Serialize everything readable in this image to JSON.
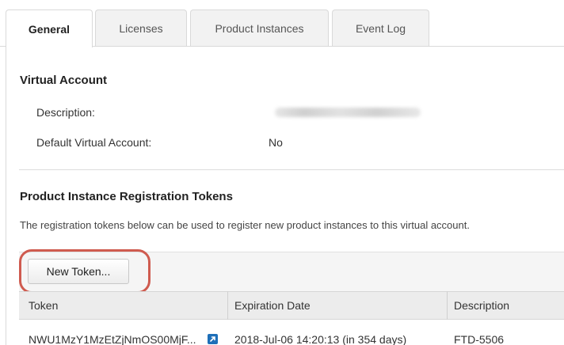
{
  "tabs": [
    {
      "label": "General",
      "active": true
    },
    {
      "label": "Licenses",
      "active": false
    },
    {
      "label": "Product Instances",
      "active": false
    },
    {
      "label": "Event Log",
      "active": false
    }
  ],
  "virtual_account": {
    "title": "Virtual Account",
    "description_label": "Description:",
    "default_label": "Default Virtual Account:",
    "default_value": "No"
  },
  "registration": {
    "title": "Product Instance Registration Tokens",
    "description": "The registration tokens below can be used to register new product instances to this virtual account.",
    "new_token_label": "New Token..."
  },
  "table": {
    "columns": [
      "Token",
      "Expiration Date",
      "Description"
    ],
    "rows": [
      {
        "token": "NWU1MzY1MzEtZjNmOS00MjF...",
        "expiration": "2018-Jul-06 14:20:13 (in 354 days)",
        "description": "FTD-5506"
      }
    ]
  },
  "colors": {
    "highlight": "#cf5b4f",
    "link_icon": "#1e6fb8"
  }
}
